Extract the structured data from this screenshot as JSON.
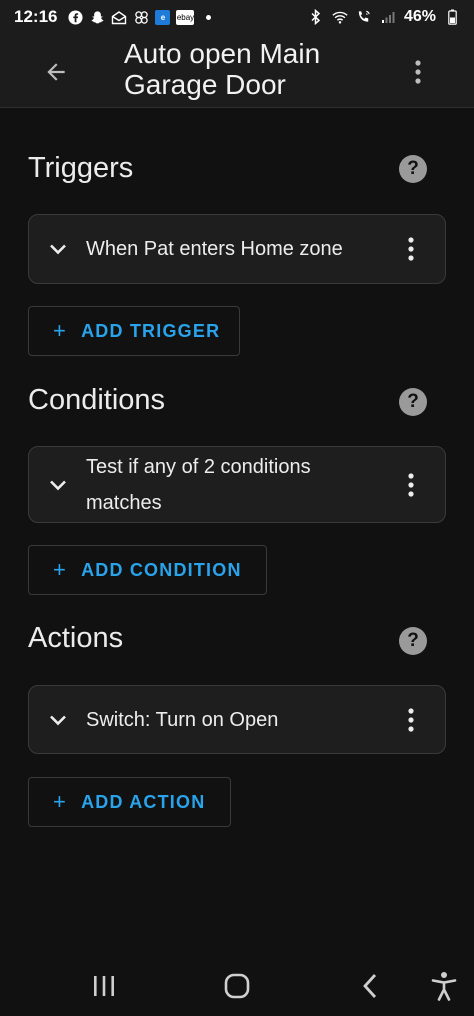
{
  "status_bar": {
    "time": "12:16",
    "left_icons": [
      "facebook-icon",
      "snapchat-icon",
      "mail-icon",
      "pinwheel-icon"
    ],
    "badge_e": "e",
    "badge_ebay": "ebay",
    "battery": "46%"
  },
  "app_bar": {
    "title_line1": "Auto open Main",
    "title_line2": "Garage Door"
  },
  "triggers": {
    "title": "Triggers",
    "items": [
      {
        "label": "When Pat enters Home zone"
      }
    ],
    "add_label": "ADD TRIGGER"
  },
  "conditions": {
    "title": "Conditions",
    "items": [
      {
        "label_line1": "Test if any of 2 conditions",
        "label_line2": "matches"
      }
    ],
    "add_label": "ADD CONDITION"
  },
  "actions": {
    "title": "Actions",
    "items": [
      {
        "label": "Switch: Turn on Open"
      }
    ],
    "add_label": "ADD ACTION"
  },
  "help_glyph": "?",
  "plus_glyph": "+",
  "colors": {
    "background": "#111111",
    "card": "#1e1e1e",
    "accent": "#29a3ec",
    "help_circle": "#9a9a9a"
  }
}
